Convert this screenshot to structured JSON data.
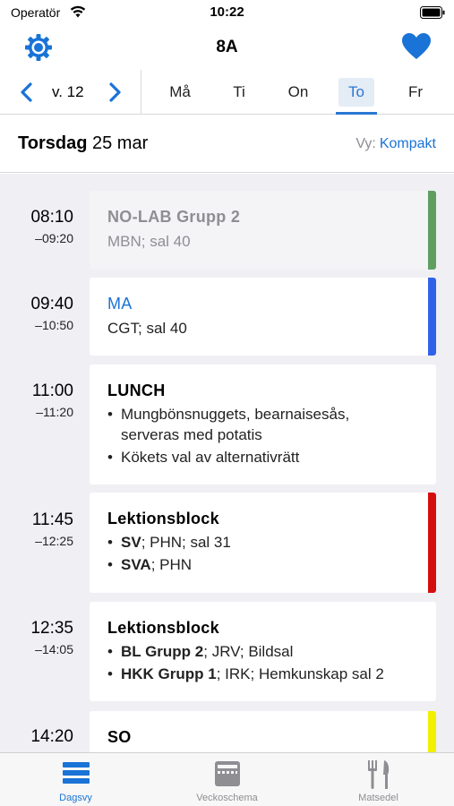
{
  "status_bar": {
    "carrier": "Operatör",
    "time": "10:22"
  },
  "nav": {
    "title": "8A",
    "settings_icon": "gear-icon",
    "favorite_icon": "heart-icon"
  },
  "week": {
    "label": "v. 12",
    "days": [
      "Må",
      "Ti",
      "On",
      "To",
      "Fr"
    ],
    "selected_day": "To"
  },
  "date_header": {
    "weekday": "Torsdag",
    "date": "25 mar",
    "view_label": "Vy:",
    "view_value": "Kompakt"
  },
  "entries": [
    {
      "start": "08:10",
      "end": "–09:20",
      "title": "NO-LAB  Grupp 2",
      "subtitle": "MBN; sal 40",
      "color": "#5f9e5f"
    },
    {
      "start": "09:40",
      "end": "–10:50",
      "title": "MA",
      "subtitle": "CGT; sal 40",
      "color": "#2f62e8"
    },
    {
      "start": "11:00",
      "end": "–11:20",
      "title": "LUNCH",
      "items": [
        "Mungbönsnuggets, bearnaisesås,",
        "serveras med potatis",
        "Kökets val av alternativrätt"
      ]
    },
    {
      "start": "11:45",
      "end": "–12:25",
      "title": "Lektionsblock",
      "items": [
        {
          "bold": "SV",
          "rest": "; PHN; sal 31"
        },
        {
          "bold": "SVA",
          "rest": "; PHN"
        }
      ],
      "color": "#d40e0e"
    },
    {
      "start": "12:35",
      "end": "–14:05",
      "title": "Lektionsblock",
      "items": [
        {
          "bold": "BL  Grupp 2",
          "rest": "; JRV; Bildsal"
        },
        {
          "bold": "HKK  Grupp 1",
          "rest": "; IRK; Hemkunskap sal 2"
        }
      ]
    },
    {
      "start": "14:20",
      "title": "SO",
      "color": "#f2ef00"
    }
  ],
  "tabs": [
    {
      "label": "Dagsvy",
      "icon": "day-view-icon",
      "active": true
    },
    {
      "label": "Veckoschema",
      "icon": "calendar-icon",
      "active": false
    },
    {
      "label": "Matsedel",
      "icon": "fork-knife-icon",
      "active": false
    }
  ],
  "colors": {
    "accent": "#1a73d6",
    "background": "#efeff4"
  }
}
